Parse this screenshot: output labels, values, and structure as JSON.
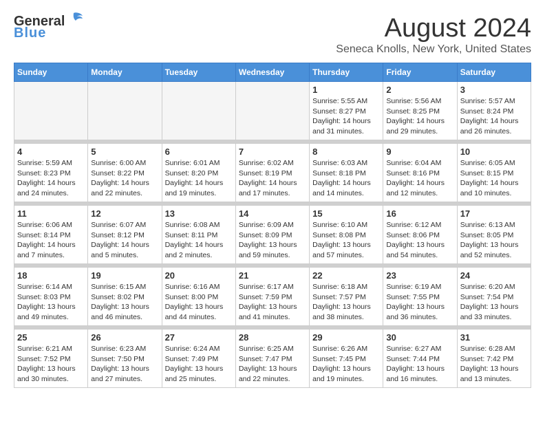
{
  "header": {
    "logo_general": "General",
    "logo_blue": "Blue",
    "month": "August 2024",
    "location": "Seneca Knolls, New York, United States"
  },
  "weekdays": [
    "Sunday",
    "Monday",
    "Tuesday",
    "Wednesday",
    "Thursday",
    "Friday",
    "Saturday"
  ],
  "weeks": [
    [
      {
        "day": "",
        "info": ""
      },
      {
        "day": "",
        "info": ""
      },
      {
        "day": "",
        "info": ""
      },
      {
        "day": "",
        "info": ""
      },
      {
        "day": "1",
        "info": "Sunrise: 5:55 AM\nSunset: 8:27 PM\nDaylight: 14 hours\nand 31 minutes."
      },
      {
        "day": "2",
        "info": "Sunrise: 5:56 AM\nSunset: 8:25 PM\nDaylight: 14 hours\nand 29 minutes."
      },
      {
        "day": "3",
        "info": "Sunrise: 5:57 AM\nSunset: 8:24 PM\nDaylight: 14 hours\nand 26 minutes."
      }
    ],
    [
      {
        "day": "4",
        "info": "Sunrise: 5:59 AM\nSunset: 8:23 PM\nDaylight: 14 hours\nand 24 minutes."
      },
      {
        "day": "5",
        "info": "Sunrise: 6:00 AM\nSunset: 8:22 PM\nDaylight: 14 hours\nand 22 minutes."
      },
      {
        "day": "6",
        "info": "Sunrise: 6:01 AM\nSunset: 8:20 PM\nDaylight: 14 hours\nand 19 minutes."
      },
      {
        "day": "7",
        "info": "Sunrise: 6:02 AM\nSunset: 8:19 PM\nDaylight: 14 hours\nand 17 minutes."
      },
      {
        "day": "8",
        "info": "Sunrise: 6:03 AM\nSunset: 8:18 PM\nDaylight: 14 hours\nand 14 minutes."
      },
      {
        "day": "9",
        "info": "Sunrise: 6:04 AM\nSunset: 8:16 PM\nDaylight: 14 hours\nand 12 minutes."
      },
      {
        "day": "10",
        "info": "Sunrise: 6:05 AM\nSunset: 8:15 PM\nDaylight: 14 hours\nand 10 minutes."
      }
    ],
    [
      {
        "day": "11",
        "info": "Sunrise: 6:06 AM\nSunset: 8:14 PM\nDaylight: 14 hours\nand 7 minutes."
      },
      {
        "day": "12",
        "info": "Sunrise: 6:07 AM\nSunset: 8:12 PM\nDaylight: 14 hours\nand 5 minutes."
      },
      {
        "day": "13",
        "info": "Sunrise: 6:08 AM\nSunset: 8:11 PM\nDaylight: 14 hours\nand 2 minutes."
      },
      {
        "day": "14",
        "info": "Sunrise: 6:09 AM\nSunset: 8:09 PM\nDaylight: 13 hours\nand 59 minutes."
      },
      {
        "day": "15",
        "info": "Sunrise: 6:10 AM\nSunset: 8:08 PM\nDaylight: 13 hours\nand 57 minutes."
      },
      {
        "day": "16",
        "info": "Sunrise: 6:12 AM\nSunset: 8:06 PM\nDaylight: 13 hours\nand 54 minutes."
      },
      {
        "day": "17",
        "info": "Sunrise: 6:13 AM\nSunset: 8:05 PM\nDaylight: 13 hours\nand 52 minutes."
      }
    ],
    [
      {
        "day": "18",
        "info": "Sunrise: 6:14 AM\nSunset: 8:03 PM\nDaylight: 13 hours\nand 49 minutes."
      },
      {
        "day": "19",
        "info": "Sunrise: 6:15 AM\nSunset: 8:02 PM\nDaylight: 13 hours\nand 46 minutes."
      },
      {
        "day": "20",
        "info": "Sunrise: 6:16 AM\nSunset: 8:00 PM\nDaylight: 13 hours\nand 44 minutes."
      },
      {
        "day": "21",
        "info": "Sunrise: 6:17 AM\nSunset: 7:59 PM\nDaylight: 13 hours\nand 41 minutes."
      },
      {
        "day": "22",
        "info": "Sunrise: 6:18 AM\nSunset: 7:57 PM\nDaylight: 13 hours\nand 38 minutes."
      },
      {
        "day": "23",
        "info": "Sunrise: 6:19 AM\nSunset: 7:55 PM\nDaylight: 13 hours\nand 36 minutes."
      },
      {
        "day": "24",
        "info": "Sunrise: 6:20 AM\nSunset: 7:54 PM\nDaylight: 13 hours\nand 33 minutes."
      }
    ],
    [
      {
        "day": "25",
        "info": "Sunrise: 6:21 AM\nSunset: 7:52 PM\nDaylight: 13 hours\nand 30 minutes."
      },
      {
        "day": "26",
        "info": "Sunrise: 6:23 AM\nSunset: 7:50 PM\nDaylight: 13 hours\nand 27 minutes."
      },
      {
        "day": "27",
        "info": "Sunrise: 6:24 AM\nSunset: 7:49 PM\nDaylight: 13 hours\nand 25 minutes."
      },
      {
        "day": "28",
        "info": "Sunrise: 6:25 AM\nSunset: 7:47 PM\nDaylight: 13 hours\nand 22 minutes."
      },
      {
        "day": "29",
        "info": "Sunrise: 6:26 AM\nSunset: 7:45 PM\nDaylight: 13 hours\nand 19 minutes."
      },
      {
        "day": "30",
        "info": "Sunrise: 6:27 AM\nSunset: 7:44 PM\nDaylight: 13 hours\nand 16 minutes."
      },
      {
        "day": "31",
        "info": "Sunrise: 6:28 AM\nSunset: 7:42 PM\nDaylight: 13 hours\nand 13 minutes."
      }
    ]
  ]
}
